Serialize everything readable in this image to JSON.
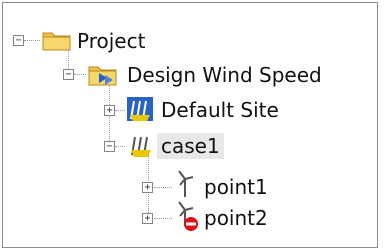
{
  "tree": {
    "root": {
      "label": "Project",
      "icon": "folder-icon",
      "expanded": true
    },
    "group": {
      "label": "Design Wind Speed",
      "icon": "folder-wind-icon",
      "expanded": true
    },
    "site": {
      "label": "Default Site",
      "icon": "turbine-group-icon",
      "expanded": false
    },
    "case": {
      "label": "case1",
      "icon": "turbine-group-icon",
      "expanded": true,
      "selected": true
    },
    "points": [
      {
        "label": "point1",
        "icon": "turbine-icon",
        "expanded": false
      },
      {
        "label": "point2",
        "icon": "turbine-stop-icon",
        "expanded": false
      }
    ]
  },
  "colors": {
    "folder": "#f0c24a",
    "accent": "#1f5fc2",
    "warning": "#e8c800",
    "stop": "#e01010"
  }
}
